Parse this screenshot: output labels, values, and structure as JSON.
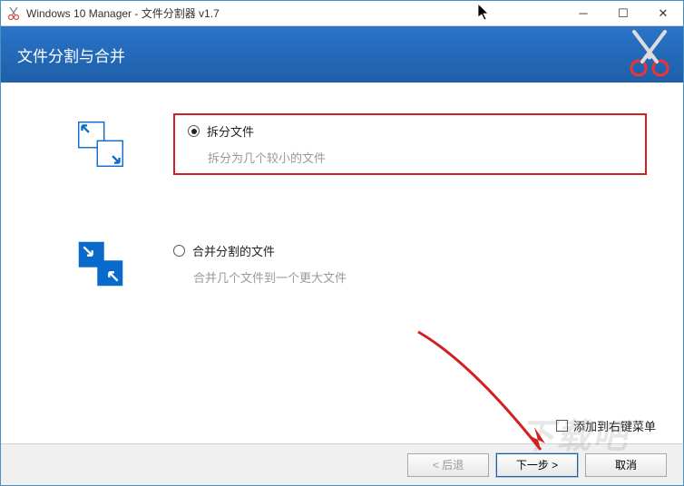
{
  "titlebar": {
    "title": "Windows 10 Manager - 文件分割器 v1.7"
  },
  "banner": {
    "title": "文件分割与合并"
  },
  "options": {
    "split": {
      "label": "拆分文件",
      "desc": "拆分为几个较小的文件",
      "selected": true
    },
    "merge": {
      "label": "合并分割的文件",
      "desc": "合并几个文件到一个更大文件",
      "selected": false
    }
  },
  "checkbox": {
    "label": "添加到右键菜单"
  },
  "buttons": {
    "back": "< 后退",
    "next": "下一步 >",
    "cancel": "取消"
  },
  "watermark": "下载吧"
}
